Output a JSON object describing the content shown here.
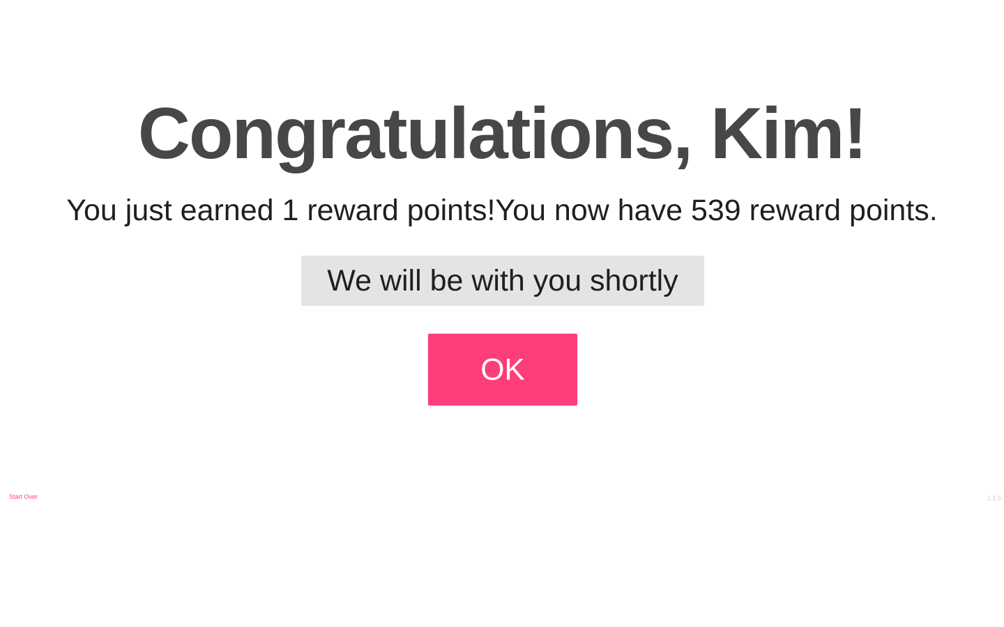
{
  "title": "Congratulations, Kim!",
  "message": "You just earned 1 reward points!You now have 539 reward points.",
  "status": "We will be with you shortly",
  "ok_button": "OK",
  "start_over": "Start Over",
  "version": "1.1.5",
  "colors": {
    "accent": "#fe3d7b",
    "title": "#474747",
    "status_bg": "#e4e4e4",
    "text": "#1f1f1f"
  }
}
